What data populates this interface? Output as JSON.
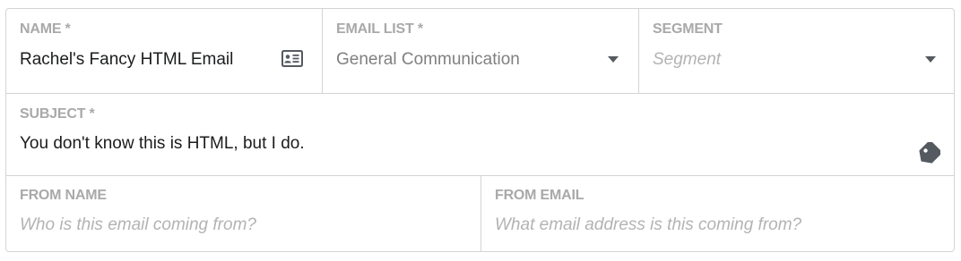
{
  "form": {
    "name": {
      "label": "NAME *",
      "value": "Rachel's Fancy HTML Email",
      "icon": "id-card-icon"
    },
    "email_list": {
      "label": "EMAIL LIST *",
      "selected": "General Communication",
      "icon": "chevron-down-icon"
    },
    "segment": {
      "label": "SEGMENT",
      "placeholder": "Segment",
      "icon": "chevron-down-icon"
    },
    "subject": {
      "label": "SUBJECT *",
      "value": "You don't know this is HTML, but I do.",
      "icon": "tag-icon"
    },
    "from_name": {
      "label": "FROM NAME",
      "placeholder": "Who is this email coming from?"
    },
    "from_email": {
      "label": "FROM EMAIL",
      "placeholder": "What email address is this coming from?"
    }
  },
  "colors": {
    "label": "#a9a9a9",
    "text": "#1b1c1d",
    "placeholder": "#b3b3b3",
    "icon": "#555a60",
    "border": "#d4d4d5"
  }
}
